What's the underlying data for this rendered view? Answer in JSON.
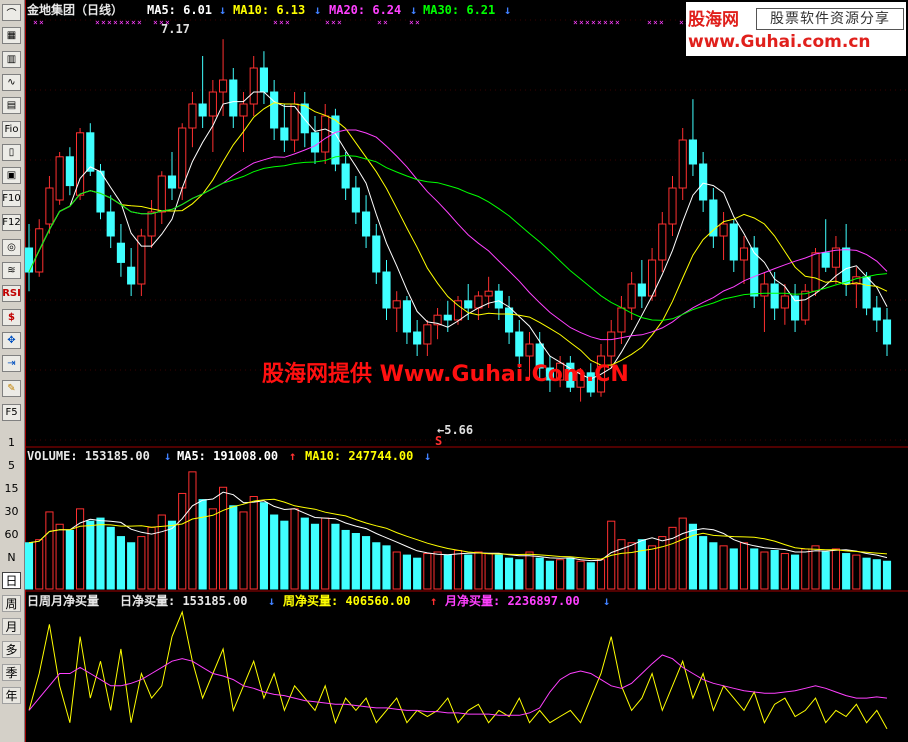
{
  "toolbar": {
    "buttons": [
      "line",
      "grid",
      "bar",
      "chart",
      "table",
      "fin",
      "book",
      "val",
      "f10",
      "f12",
      "find",
      "mkt",
      "rsi",
      "money",
      "move",
      "export",
      "pen",
      "f5"
    ],
    "nums": [
      "1",
      "5",
      "15",
      "30",
      "60",
      "N"
    ],
    "periods": [
      "日",
      "周",
      "月",
      "多",
      "季",
      "年"
    ],
    "active_period": "日"
  },
  "header": {
    "stock": "金地集团（日线）",
    "ma5_label": "MA5: 6.01",
    "ma10_label": "MA10: 6.13",
    "ma20_label": "MA20: 6.24",
    "ma30_label": "MA30: 6.21",
    "arrow_down": "↓",
    "arrow_up": "↑"
  },
  "price_annotations": {
    "high": "7.17",
    "low": "←5.66",
    "signal": "S"
  },
  "volume_header": {
    "volume": "VOLUME: 153185.00",
    "ma5": "MA5: 191008.00",
    "ma10": "MA10: 247744.00"
  },
  "net_header": {
    "title": "日周月净买量",
    "day": "日净买量: 153185.00",
    "week": "周净买量: 406560.00",
    "month": "月净买量: 2236897.00"
  },
  "logo": {
    "line1": "股海网",
    "line2": "股票软件资源分享",
    "line3": "www.Guhai.com.cn"
  },
  "watermark": "股海网提供 Www.Guhai.Com.CN",
  "colors": {
    "up": "#ff3030",
    "down": "#40ffff",
    "ma5": "#ffffff",
    "ma10": "#ffff00",
    "ma20": "#ff40ff",
    "ma30": "#00ff00",
    "border": "#a00000",
    "grid": "#800000"
  },
  "chart_data": {
    "type": "candlestick",
    "price": {
      "ylim": [
        5.5,
        7.25
      ],
      "candles": [
        [
          6.3,
          6.4,
          6.12,
          6.2
        ],
        [
          6.2,
          6.42,
          6.18,
          6.38
        ],
        [
          6.4,
          6.6,
          6.36,
          6.55
        ],
        [
          6.5,
          6.7,
          6.48,
          6.68
        ],
        [
          6.68,
          6.72,
          6.52,
          6.56
        ],
        [
          6.52,
          6.8,
          6.5,
          6.78
        ],
        [
          6.78,
          6.82,
          6.6,
          6.62
        ],
        [
          6.62,
          6.65,
          6.42,
          6.45
        ],
        [
          6.45,
          6.52,
          6.3,
          6.35
        ],
        [
          6.32,
          6.4,
          6.18,
          6.24
        ],
        [
          6.22,
          6.3,
          6.1,
          6.15
        ],
        [
          6.15,
          6.38,
          6.1,
          6.35
        ],
        [
          6.35,
          6.5,
          6.3,
          6.45
        ],
        [
          6.45,
          6.62,
          6.4,
          6.6
        ],
        [
          6.6,
          6.7,
          6.5,
          6.55
        ],
        [
          6.55,
          6.82,
          6.5,
          6.8
        ],
        [
          6.8,
          6.95,
          6.72,
          6.9
        ],
        [
          6.9,
          7.1,
          6.8,
          6.85
        ],
        [
          6.85,
          7.0,
          6.7,
          6.95
        ],
        [
          6.95,
          7.17,
          6.85,
          7.0
        ],
        [
          7.0,
          7.05,
          6.8,
          6.85
        ],
        [
          6.85,
          6.95,
          6.7,
          6.9
        ],
        [
          6.9,
          7.1,
          6.85,
          7.05
        ],
        [
          7.05,
          7.12,
          6.9,
          6.95
        ],
        [
          6.95,
          7.0,
          6.75,
          6.8
        ],
        [
          6.8,
          6.9,
          6.7,
          6.75
        ],
        [
          6.75,
          6.95,
          6.7,
          6.9
        ],
        [
          6.9,
          6.95,
          6.72,
          6.78
        ],
        [
          6.78,
          6.85,
          6.65,
          6.7
        ],
        [
          6.7,
          6.9,
          6.65,
          6.85
        ],
        [
          6.85,
          6.88,
          6.62,
          6.65
        ],
        [
          6.65,
          6.7,
          6.5,
          6.55
        ],
        [
          6.55,
          6.6,
          6.4,
          6.45
        ],
        [
          6.45,
          6.52,
          6.3,
          6.35
        ],
        [
          6.35,
          6.4,
          6.15,
          6.2
        ],
        [
          6.2,
          6.25,
          6.0,
          6.05
        ],
        [
          6.05,
          6.12,
          5.95,
          6.08
        ],
        [
          6.08,
          6.1,
          5.9,
          5.95
        ],
        [
          5.95,
          6.0,
          5.85,
          5.9
        ],
        [
          5.9,
          6.0,
          5.85,
          5.98
        ],
        [
          5.98,
          6.05,
          5.92,
          6.02
        ],
        [
          6.02,
          6.08,
          5.95,
          6.0
        ],
        [
          6.0,
          6.1,
          5.98,
          6.08
        ],
        [
          6.08,
          6.15,
          6.0,
          6.05
        ],
        [
          6.05,
          6.12,
          6.0,
          6.1
        ],
        [
          6.1,
          6.18,
          6.05,
          6.12
        ],
        [
          6.12,
          6.15,
          6.0,
          6.05
        ],
        [
          6.05,
          6.1,
          5.9,
          5.95
        ],
        [
          5.95,
          6.0,
          5.8,
          5.85
        ],
        [
          5.85,
          5.95,
          5.75,
          5.9
        ],
        [
          5.9,
          5.95,
          5.75,
          5.8
        ],
        [
          5.8,
          5.85,
          5.7,
          5.75
        ],
        [
          5.75,
          5.85,
          5.72,
          5.82
        ],
        [
          5.82,
          5.85,
          5.7,
          5.72
        ],
        [
          5.72,
          5.8,
          5.66,
          5.78
        ],
        [
          5.78,
          5.82,
          5.68,
          5.7
        ],
        [
          5.7,
          5.9,
          5.68,
          5.85
        ],
        [
          5.85,
          6.0,
          5.8,
          5.95
        ],
        [
          5.95,
          6.1,
          5.9,
          6.05
        ],
        [
          6.05,
          6.2,
          6.0,
          6.15
        ],
        [
          6.15,
          6.25,
          6.05,
          6.1
        ],
        [
          6.1,
          6.3,
          6.08,
          6.25
        ],
        [
          6.25,
          6.45,
          6.2,
          6.4
        ],
        [
          6.4,
          6.6,
          6.35,
          6.55
        ],
        [
          6.55,
          6.8,
          6.5,
          6.75
        ],
        [
          6.75,
          6.92,
          6.6,
          6.65
        ],
        [
          6.65,
          6.7,
          6.45,
          6.5
        ],
        [
          6.5,
          6.55,
          6.3,
          6.35
        ],
        [
          6.35,
          6.45,
          6.25,
          6.4
        ],
        [
          6.4,
          6.42,
          6.2,
          6.25
        ],
        [
          6.25,
          6.35,
          6.15,
          6.3
        ],
        [
          6.3,
          6.35,
          6.05,
          6.1
        ],
        [
          6.1,
          6.2,
          5.95,
          6.15
        ],
        [
          6.15,
          6.2,
          6.0,
          6.05
        ],
        [
          6.05,
          6.15,
          5.98,
          6.1
        ],
        [
          6.1,
          6.15,
          5.95,
          6.0
        ],
        [
          6.0,
          6.15,
          5.98,
          6.12
        ],
        [
          6.12,
          6.3,
          6.1,
          6.28
        ],
        [
          6.28,
          6.42,
          6.2,
          6.22
        ],
        [
          6.22,
          6.35,
          6.15,
          6.3
        ],
        [
          6.3,
          6.4,
          6.1,
          6.15
        ],
        [
          6.15,
          6.22,
          6.05,
          6.18
        ],
        [
          6.18,
          6.2,
          6.02,
          6.05
        ],
        [
          6.05,
          6.1,
          5.95,
          6.0
        ],
        [
          6.0,
          6.05,
          5.85,
          5.9
        ]
      ]
    },
    "volume": {
      "series": [
        {
          "name": "VOLUME",
          "values": [
            150,
            160,
            250,
            210,
            190,
            260,
            220,
            230,
            200,
            170,
            150,
            170,
            200,
            240,
            220,
            310,
            380,
            290,
            260,
            330,
            270,
            250,
            300,
            280,
            240,
            220,
            260,
            230,
            210,
            230,
            210,
            190,
            180,
            170,
            150,
            140,
            120,
            110,
            100,
            115,
            120,
            110,
            125,
            110,
            120,
            115,
            110,
            100,
            95,
            120,
            100,
            90,
            95,
            100,
            90,
            85,
            95,
            220,
            160,
            150,
            160,
            140,
            170,
            200,
            230,
            210,
            170,
            150,
            140,
            130,
            150,
            130,
            120,
            125,
            115,
            110,
            130,
            140,
            120,
            130,
            115,
            110,
            100,
            95,
            90
          ]
        }
      ]
    },
    "net_volume": {
      "series": [
        {
          "name": "日净买量",
          "values": [
            0.2,
            0.5,
            0.9,
            0.4,
            0.1,
            0.8,
            0.3,
            0.6,
            0.2,
            0.7,
            0.1,
            0.5,
            0.3,
            0.4,
            0.8,
            1.0,
            0.6,
            0.3,
            0.5,
            0.7,
            0.2,
            0.4,
            0.6,
            0.3,
            0.5,
            0.2,
            0.4,
            0.3,
            0.2,
            0.4,
            0.1,
            0.3,
            0.2,
            0.3,
            0.1,
            0.2,
            0.3,
            0.1,
            0.2,
            0.15,
            0.2,
            0.3,
            0.1,
            0.2,
            0.25,
            0.1,
            0.2,
            0.15,
            0.3,
            0.1,
            0.2,
            0.1,
            0.15,
            0.2,
            0.1,
            0.3,
            0.5,
            0.8,
            0.4,
            0.2,
            0.3,
            0.5,
            0.2,
            0.4,
            0.6,
            0.3,
            0.5,
            0.2,
            0.4,
            0.3,
            0.2,
            0.35,
            0.1,
            0.25,
            0.3,
            0.15,
            0.2,
            0.3,
            0.1,
            0.2,
            0.15,
            0.25,
            0.1,
            0.2,
            0.05
          ]
        },
        {
          "name": "周净买量",
          "values": [
            0.2,
            0.3,
            0.4,
            0.5,
            0.5,
            0.55,
            0.5,
            0.45,
            0.4,
            0.4,
            0.42,
            0.45,
            0.5,
            0.55,
            0.6,
            0.62,
            0.6,
            0.55,
            0.5,
            0.48,
            0.45,
            0.4,
            0.38,
            0.35,
            0.33,
            0.32,
            0.3,
            0.28,
            0.27,
            0.26,
            0.25,
            0.25,
            0.24,
            0.23,
            0.22,
            0.22,
            0.21,
            0.2,
            0.2,
            0.19,
            0.19,
            0.18,
            0.18,
            0.17,
            0.17,
            0.17,
            0.16,
            0.16,
            0.16,
            0.18,
            0.22,
            0.35,
            0.45,
            0.5,
            0.52,
            0.5,
            0.45,
            0.4,
            0.38,
            0.42,
            0.5,
            0.58,
            0.65,
            0.62,
            0.55,
            0.5,
            0.45,
            0.42,
            0.4,
            0.38,
            0.36,
            0.35,
            0.34,
            0.34,
            0.35,
            0.36,
            0.38,
            0.4,
            0.38,
            0.35,
            0.32,
            0.3,
            0.3,
            0.31,
            0.3
          ]
        }
      ]
    }
  }
}
